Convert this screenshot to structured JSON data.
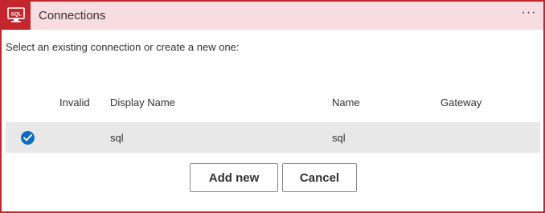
{
  "header": {
    "icon_label": "SQL",
    "title": "Connections",
    "more_label": "···"
  },
  "instructions": "Select an existing connection or create a new one:",
  "table": {
    "columns": [
      "Invalid",
      "Display Name",
      "Name",
      "Gateway"
    ],
    "rows": [
      {
        "selected": true,
        "invalid": "",
        "display_name": "sql",
        "name": "sql",
        "gateway": ""
      }
    ]
  },
  "actions": {
    "add_new_label": "Add new",
    "cancel_label": "Cancel"
  },
  "colors": {
    "accent": "#c4262e",
    "header_bg": "#f8dde0",
    "check": "#0f6cbd",
    "row_bg": "#e8e8e8"
  }
}
